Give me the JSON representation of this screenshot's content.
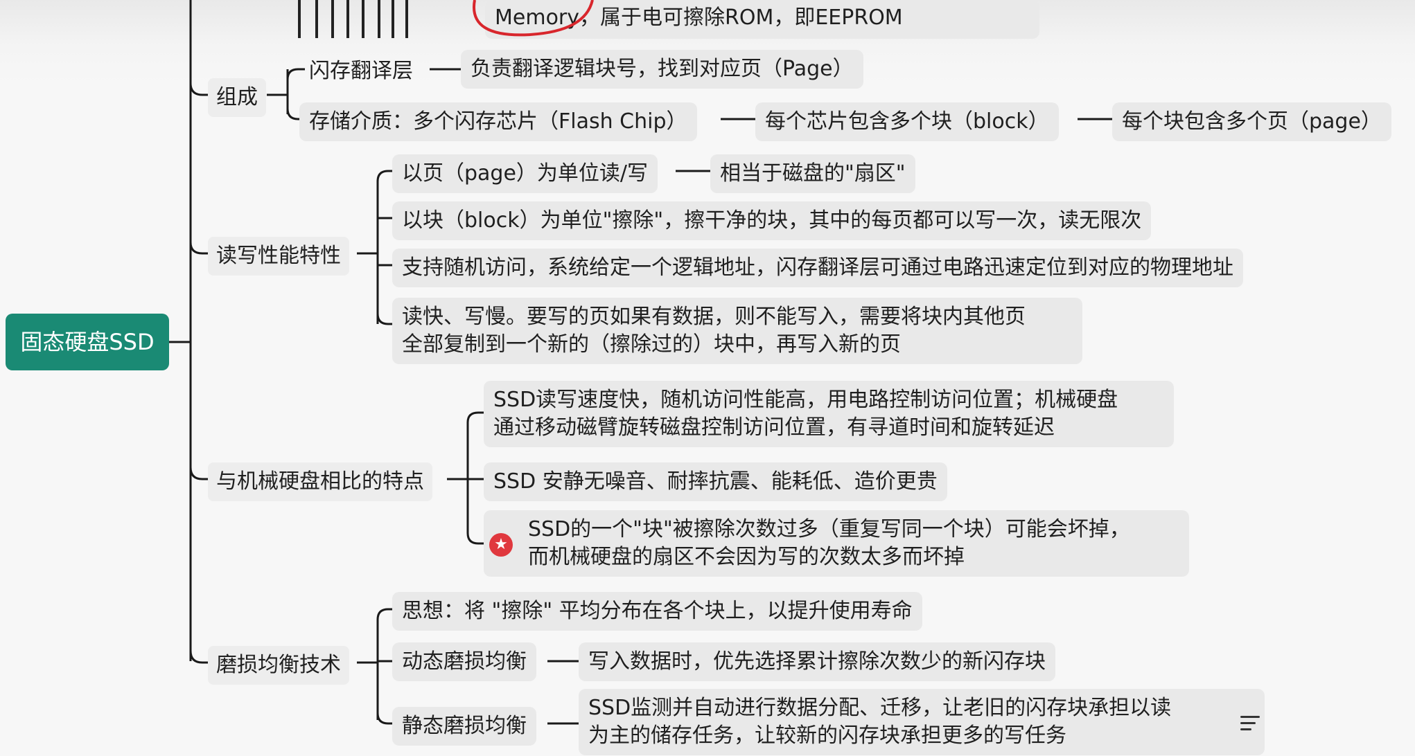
{
  "top_fragment": "Memory，属于电可擦除ROM，即EEPROM",
  "root": "固态硬盘SSD",
  "branches": {
    "zucheng": {
      "label": "组成",
      "ftl": "闪存翻译层",
      "ftl_desc": "负责翻译逻辑块号，找到对应页（Page）",
      "medium": "存储介质：多个闪存芯片（Flash Chip）",
      "chip_blocks": "每个芯片包含多个块（block）",
      "block_pages": "每个块包含多个页（page）"
    },
    "rw": {
      "label": "读写性能特性",
      "item1": "以页（page）为单位读/写",
      "item1_note": "相当于磁盘的\"扇区\"",
      "item2": "以块（block）为单位\"擦除\"，擦干净的块，其中的每页都可以写一次，读无限次",
      "item3": "支持随机访问，系统给定一个逻辑地址，闪存翻译层可通过电路迅速定位到对应的物理地址",
      "item4_line1": "读快、写慢。要写的页如果有数据，则不能写入，需要将块内其他页",
      "item4_line2": "全部复制到一个新的（擦除过的）块中，再写入新的页"
    },
    "compare": {
      "label": "与机械硬盘相比的特点",
      "item1_line1": "SSD读写速度快，随机访问性能高，用电路控制访问位置；机械硬盘",
      "item1_line2": "通过移动磁臂旋转磁盘控制访问位置，有寻道时间和旋转延迟",
      "item2": "SSD 安静无噪音、耐摔抗震、能耗低、造价更贵",
      "item3_line1": "SSD的一个\"块\"被擦除次数过多（重复写同一个块）可能会坏掉，",
      "item3_line2": "而机械硬盘的扇区不会因为写的次数太多而坏掉"
    },
    "wear": {
      "label": "磨损均衡技术",
      "idea": "思想：将 \"擦除\" 平均分布在各个块上，以提升使用寿命",
      "dynamic": "动态磨损均衡",
      "dynamic_desc": "写入数据时，优先选择累计擦除次数少的新闪存块",
      "static": "静态磨损均衡",
      "static_line1": "SSD监测并自动进行数据分配、迁移，让老旧的闪存块承担以读",
      "static_line2": "为主的储存任务，让较新的闪存块承担更多的写任务"
    }
  },
  "colors": {
    "root_bg": "#1a8a74",
    "node_bg": "#e9e9e9",
    "star": "#e0383e",
    "annotation": "#d8262c"
  },
  "icons": {
    "star": "star-icon",
    "menu": "menu-icon"
  }
}
